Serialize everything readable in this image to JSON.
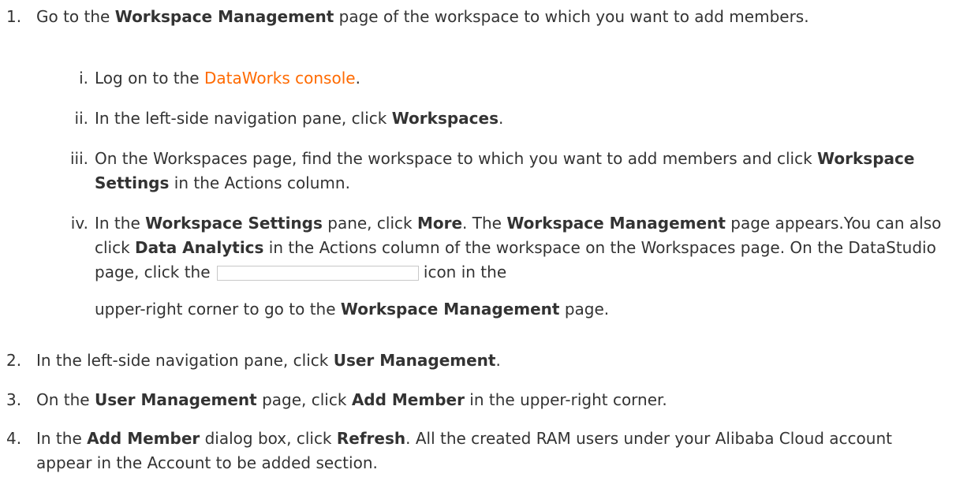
{
  "steps": [
    {
      "num": "1.",
      "text_a": "Go to the ",
      "bold_a": "Workspace Management",
      "text_b": " page of the workspace to which you want to add members.",
      "substeps": [
        {
          "num": "i.",
          "text_a": "Log on to the ",
          "link": "DataWorks console",
          "text_b": "."
        },
        {
          "num": "ii.",
          "text_a": "In the left-side navigation pane, click ",
          "bold_a": "Workspaces",
          "text_b": "."
        },
        {
          "num": "iii.",
          "text_a": "On the Workspaces page, find the workspace to which you want to add members and click ",
          "bold_a": "Workspace Settings",
          "text_b": " in the Actions column."
        },
        {
          "num": "iv.",
          "text_a": "In the ",
          "bold_a": "Workspace Settings",
          "text_b": " pane, click ",
          "bold_b": "More",
          "text_c": ". The ",
          "bold_c": "Workspace Management",
          "text_d": " page appears.You can also click ",
          "bold_d": "Data Analytics",
          "text_e": " in the Actions column of the workspace on the Workspaces page. On the DataStudio page, click the ",
          "text_f": "icon in the",
          "text_g": "upper-right corner to go to the ",
          "bold_e": "Workspace Management",
          "text_h": " page."
        }
      ]
    },
    {
      "num": "2.",
      "text_a": "In the left-side navigation pane, click ",
      "bold_a": "User Management",
      "text_b": "."
    },
    {
      "num": "3.",
      "text_a": "On the ",
      "bold_a": "User Management",
      "text_b": " page, click ",
      "bold_b": "Add Member",
      "text_c": " in the upper-right corner."
    },
    {
      "num": "4.",
      "text_a": "In the ",
      "bold_a": "Add Member",
      "text_b": " dialog box, click ",
      "bold_b": "Refresh",
      "text_c": ". All the created RAM users under your Alibaba Cloud account appear in the Account to be added section."
    }
  ]
}
